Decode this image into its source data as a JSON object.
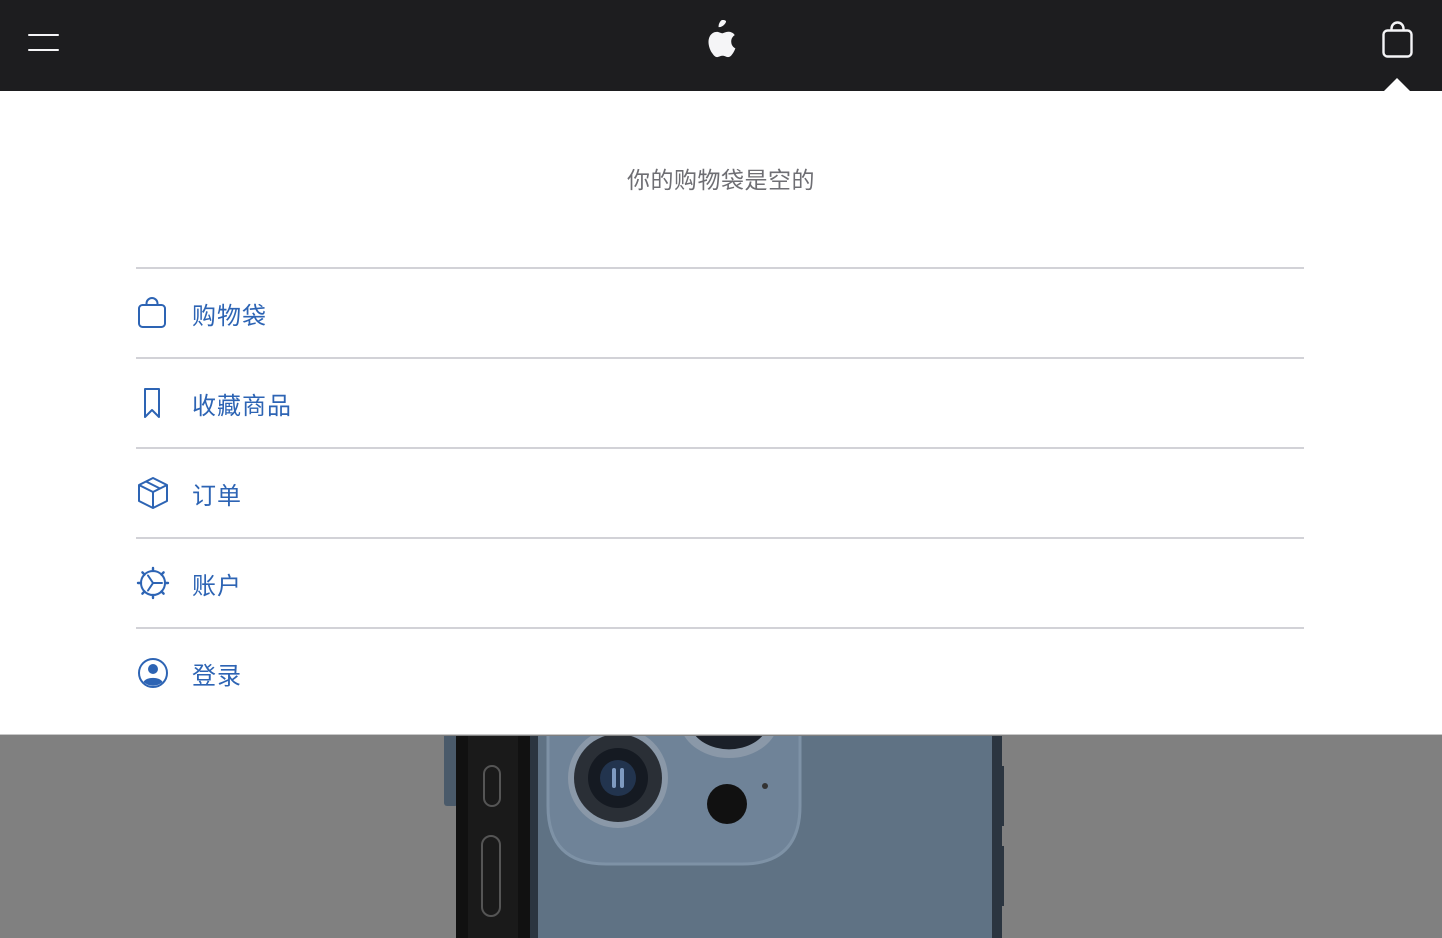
{
  "nav": {
    "menu_icon": "hamburger-menu-icon",
    "logo_icon": "apple-logo-icon",
    "bag_icon": "shopping-bag-icon"
  },
  "bag_flyout": {
    "empty_message": "你的购物袋是空的",
    "items": [
      {
        "label": "购物袋",
        "icon": "shopping-bag-icon"
      },
      {
        "label": "收藏商品",
        "icon": "bookmark-icon"
      },
      {
        "label": "订单",
        "icon": "box-icon"
      },
      {
        "label": "账户",
        "icon": "gear-icon"
      },
      {
        "label": "登录",
        "icon": "user-circle-icon"
      }
    ]
  },
  "colors": {
    "nav_background": "#1d1d1f",
    "link_blue": "#2d64b4",
    "message_gray": "#6e6e73",
    "overlay_gray": "#808080"
  }
}
